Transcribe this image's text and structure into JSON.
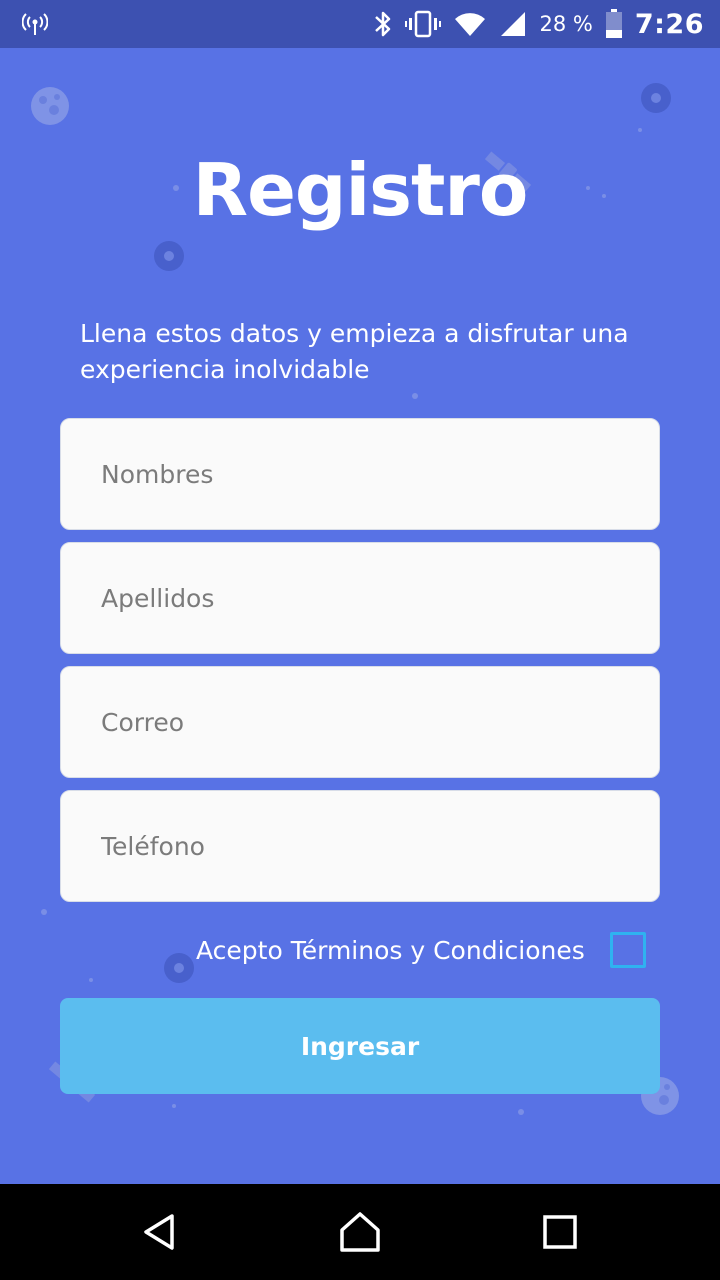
{
  "status_bar": {
    "battery_percent": "28 %",
    "time": "7:26",
    "icons": [
      "hotspot-icon",
      "bluetooth-icon",
      "vibrate-icon",
      "wifi-icon",
      "signal-icon",
      "battery-icon"
    ]
  },
  "page": {
    "title": "Registro",
    "subtitle": "Llena estos datos y empieza a disfrutar una experiencia inolvidable"
  },
  "form": {
    "nombres_placeholder": "Nombres",
    "apellidos_placeholder": "Apellidos",
    "correo_placeholder": "Correo",
    "telefono_placeholder": "Teléfono",
    "terms_label": "Acepto Términos y Condiciones",
    "terms_checked": false,
    "submit_label": "Ingresar"
  },
  "nav_bar": {
    "icons": [
      "back-icon",
      "home-icon",
      "recents-icon"
    ]
  },
  "colors": {
    "background": "#5872e5",
    "status_bar": "#3d51b1",
    "button": "#5bbdef",
    "checkbox_border": "#2fb2f0"
  }
}
